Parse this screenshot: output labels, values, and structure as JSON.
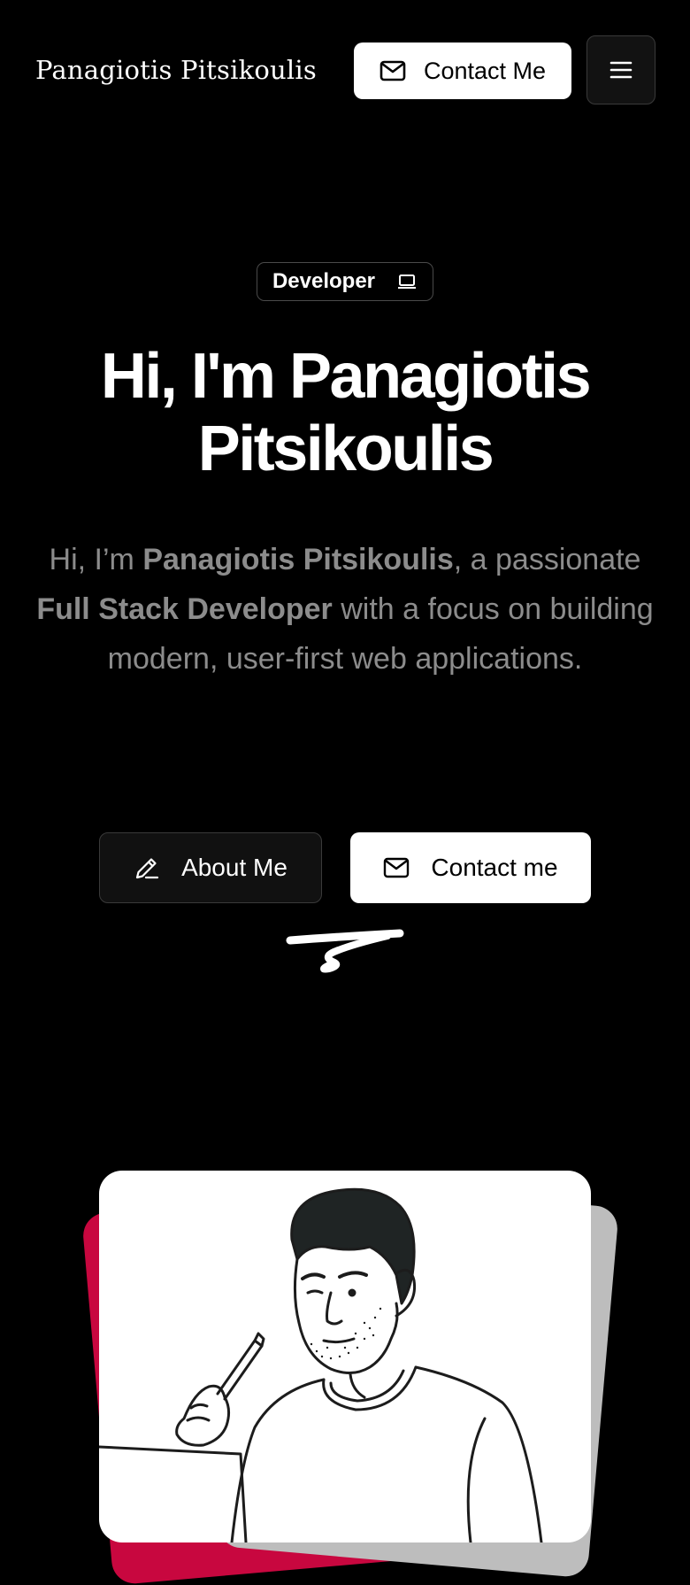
{
  "header": {
    "site_name": "Panagiotis Pitsikoulis",
    "contact_label": "Contact Me",
    "contact_icon": "mail-icon",
    "menu_icon": "hamburger-menu-icon"
  },
  "hero": {
    "badge_label": "Developer",
    "badge_icon": "laptop-icon",
    "title_line1": "Hi, I'm Panagiotis",
    "title_line2": "Pitsikoulis",
    "intro_prefix": "Hi, I’m ",
    "intro_name": "Panagiotis Pitsikoulis",
    "intro_middle": ", a passionate ",
    "intro_role": "Full Stack Developer",
    "intro_suffix": " with a focus on building modern, user-first web applications.",
    "about_button_label": "About Me",
    "about_button_icon": "pencil-icon",
    "contact_button_label": "Contact me",
    "contact_button_icon": "mail-icon"
  },
  "illustration": {
    "subject": "developer-portrait-illustration",
    "left_card_color": "#c8073f",
    "right_card_color": "#bdbdbd",
    "front_card_color": "#ffffff"
  },
  "colors": {
    "background": "#000000",
    "text_primary": "#ffffff",
    "text_muted": "#8c8c8c",
    "accent": "#c8073f"
  }
}
